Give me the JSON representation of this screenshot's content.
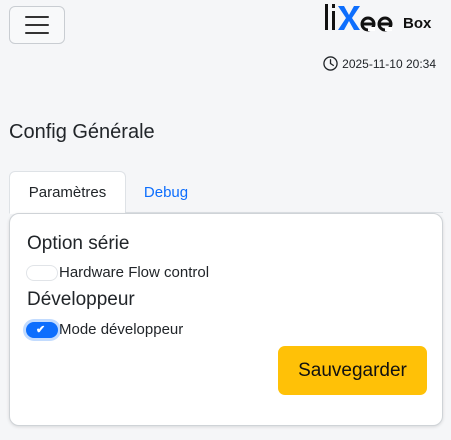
{
  "header": {
    "menu_icon": "hamburger-icon",
    "logo_text": "liXee",
    "logo_suffix": "Box",
    "datetime": "2025-11-10 20:34",
    "clock_icon": "clock-icon"
  },
  "page": {
    "title": "Config Générale"
  },
  "tabs": [
    {
      "label": "Paramètres",
      "active": true
    },
    {
      "label": "Debug",
      "active": false
    }
  ],
  "card": {
    "sections": [
      {
        "title": "Option série",
        "switch": {
          "label": "Hardware Flow control",
          "checked": false
        }
      },
      {
        "title": "Développeur",
        "switch": {
          "label": "Mode développeur",
          "checked": true
        }
      }
    ],
    "save_label": "Sauvegarder"
  },
  "colors": {
    "accent": "#0d6efd",
    "save_button": "#ffc107",
    "logo_x": "#0d6efd",
    "background": "#f5f6f8"
  }
}
